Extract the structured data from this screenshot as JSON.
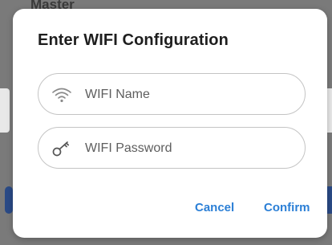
{
  "background": {
    "header_text": "Master"
  },
  "dialog": {
    "title": "Enter WIFI Configuration",
    "fields": {
      "wifi_name": {
        "placeholder": "WIFI Name",
        "value": "",
        "icon": "wifi-icon"
      },
      "wifi_password": {
        "placeholder": "WIFI Password",
        "value": "",
        "icon": "key-icon"
      }
    },
    "buttons": {
      "cancel": "Cancel",
      "confirm": "Confirm"
    }
  },
  "colors": {
    "accent": "#2b7fd6",
    "backdrop": "#7a7a7a",
    "dialog_bg": "#ffffff",
    "field_border": "#c4c4c4"
  }
}
